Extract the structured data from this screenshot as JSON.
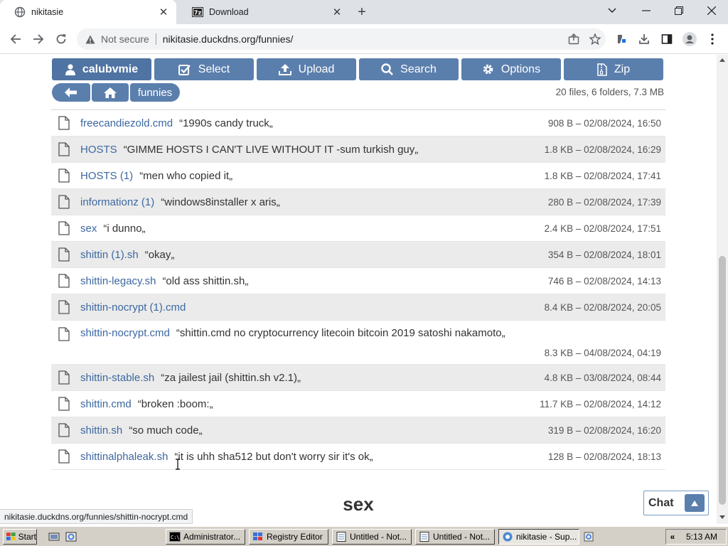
{
  "browser": {
    "tabs": [
      {
        "title": "nikitasie",
        "active": true
      },
      {
        "title": "Download",
        "active": false
      }
    ],
    "security_label": "Not secure",
    "url": "nikitasie.duckdns.org/funnies/",
    "status_url": "nikitasie.duckdns.org/funnies/shittin-nocrypt.cmd"
  },
  "actions": [
    {
      "label": "calubvmie",
      "icon": "user-icon"
    },
    {
      "label": "Select",
      "icon": "checkbox-icon"
    },
    {
      "label": "Upload",
      "icon": "upload-icon"
    },
    {
      "label": "Search",
      "icon": "search-icon"
    },
    {
      "label": "Options",
      "icon": "gear-icon"
    },
    {
      "label": "Zip",
      "icon": "zip-file-icon"
    }
  ],
  "breadcrumb": {
    "folder": "funnies"
  },
  "summary": "20 files, 6 folders, 7.3 MB",
  "files": [
    {
      "name": "freecandiezold.cmd",
      "desc": "“1990s candy truck„",
      "meta": "908 B – 02/08/2024, 16:50"
    },
    {
      "name": "HOSTS",
      "desc": "“GIMME HOSTS I CAN'T LIVE WITHOUT IT -sum turkish guy„",
      "meta": "1.8 KB – 02/08/2024, 16:29"
    },
    {
      "name": "HOSTS (1)",
      "desc": "“men who copied it„",
      "meta": "1.8 KB – 02/08/2024, 17:41"
    },
    {
      "name": "informationz (1)",
      "desc": "“windows8installer x aris„",
      "meta": "280 B – 02/08/2024, 17:39"
    },
    {
      "name": "sex",
      "desc": "“i dunno„",
      "meta": "2.4 KB – 02/08/2024, 17:51"
    },
    {
      "name": "shittin (1).sh",
      "desc": "“okay„",
      "meta": "354 B – 02/08/2024, 18:01"
    },
    {
      "name": "shittin-legacy.sh",
      "desc": "“old ass shittin.sh„",
      "meta": "746 B – 02/08/2024, 14:13"
    },
    {
      "name": "shittin-nocrypt (1).cmd",
      "desc": "",
      "meta": "8.4 KB – 02/08/2024, 20:05"
    },
    {
      "name": "shittin-nocrypt.cmd",
      "desc": "“shittin.cmd no cryptocurrency litecoin bitcoin 2019 satoshi nakamoto„",
      "meta": "8.3 KB – 04/08/2024, 04:19"
    },
    {
      "name": "shittin-stable.sh",
      "desc": "“za jailest jail (shittin.sh v2.1)„",
      "meta": "4.8 KB – 03/08/2024, 08:44"
    },
    {
      "name": "shittin.cmd",
      "desc": "“broken :boom:„",
      "meta": "11.7 KB – 02/08/2024, 14:12"
    },
    {
      "name": "shittin.sh",
      "desc": "“so much code„",
      "meta": "319 B – 02/08/2024, 16:20"
    },
    {
      "name": "shittinalphaleak.sh",
      "desc": "“it is uhh sha512 but don't worry sir it's ok„",
      "meta": "128 B – 02/08/2024, 18:13"
    }
  ],
  "footer_title": "sex",
  "chat": {
    "label": "Chat"
  },
  "taskbar": {
    "start_label": "Start",
    "tasks": [
      {
        "label": "Administrator...",
        "active": false
      },
      {
        "label": "Registry Editor",
        "active": false
      },
      {
        "label": "Untitled - Not...",
        "active": false
      },
      {
        "label": "Untitled - Not...",
        "active": false
      },
      {
        "label": "nikitasie - Sup...",
        "active": true
      }
    ],
    "clock": "5:13 AM"
  },
  "colors": {
    "accent": "#5b7fad",
    "link": "#3c68a1"
  }
}
